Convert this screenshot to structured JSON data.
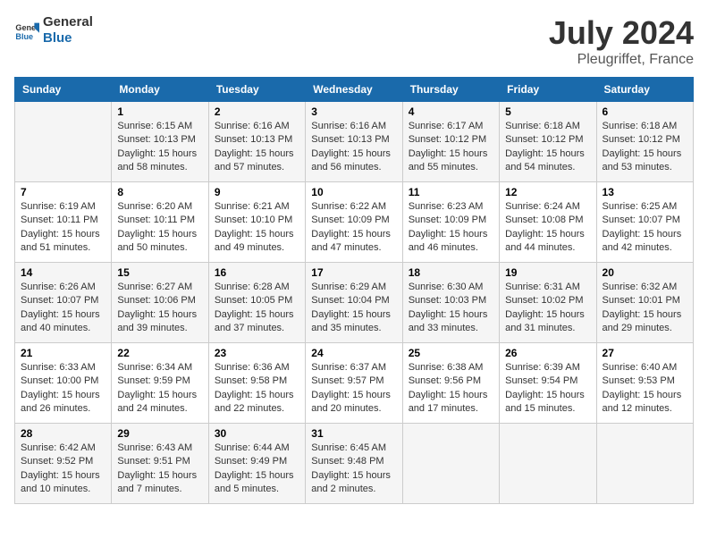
{
  "header": {
    "logo_line1": "General",
    "logo_line2": "Blue",
    "month": "July 2024",
    "location": "Pleugriffet, France"
  },
  "weekdays": [
    "Sunday",
    "Monday",
    "Tuesday",
    "Wednesday",
    "Thursday",
    "Friday",
    "Saturday"
  ],
  "weeks": [
    [
      {
        "day": "",
        "sunrise": "",
        "sunset": "",
        "daylight": ""
      },
      {
        "day": "1",
        "sunrise": "Sunrise: 6:15 AM",
        "sunset": "Sunset: 10:13 PM",
        "daylight": "Daylight: 15 hours and 58 minutes."
      },
      {
        "day": "2",
        "sunrise": "Sunrise: 6:16 AM",
        "sunset": "Sunset: 10:13 PM",
        "daylight": "Daylight: 15 hours and 57 minutes."
      },
      {
        "day": "3",
        "sunrise": "Sunrise: 6:16 AM",
        "sunset": "Sunset: 10:13 PM",
        "daylight": "Daylight: 15 hours and 56 minutes."
      },
      {
        "day": "4",
        "sunrise": "Sunrise: 6:17 AM",
        "sunset": "Sunset: 10:12 PM",
        "daylight": "Daylight: 15 hours and 55 minutes."
      },
      {
        "day": "5",
        "sunrise": "Sunrise: 6:18 AM",
        "sunset": "Sunset: 10:12 PM",
        "daylight": "Daylight: 15 hours and 54 minutes."
      },
      {
        "day": "6",
        "sunrise": "Sunrise: 6:18 AM",
        "sunset": "Sunset: 10:12 PM",
        "daylight": "Daylight: 15 hours and 53 minutes."
      }
    ],
    [
      {
        "day": "7",
        "sunrise": "Sunrise: 6:19 AM",
        "sunset": "Sunset: 10:11 PM",
        "daylight": "Daylight: 15 hours and 51 minutes."
      },
      {
        "day": "8",
        "sunrise": "Sunrise: 6:20 AM",
        "sunset": "Sunset: 10:11 PM",
        "daylight": "Daylight: 15 hours and 50 minutes."
      },
      {
        "day": "9",
        "sunrise": "Sunrise: 6:21 AM",
        "sunset": "Sunset: 10:10 PM",
        "daylight": "Daylight: 15 hours and 49 minutes."
      },
      {
        "day": "10",
        "sunrise": "Sunrise: 6:22 AM",
        "sunset": "Sunset: 10:09 PM",
        "daylight": "Daylight: 15 hours and 47 minutes."
      },
      {
        "day": "11",
        "sunrise": "Sunrise: 6:23 AM",
        "sunset": "Sunset: 10:09 PM",
        "daylight": "Daylight: 15 hours and 46 minutes."
      },
      {
        "day": "12",
        "sunrise": "Sunrise: 6:24 AM",
        "sunset": "Sunset: 10:08 PM",
        "daylight": "Daylight: 15 hours and 44 minutes."
      },
      {
        "day": "13",
        "sunrise": "Sunrise: 6:25 AM",
        "sunset": "Sunset: 10:07 PM",
        "daylight": "Daylight: 15 hours and 42 minutes."
      }
    ],
    [
      {
        "day": "14",
        "sunrise": "Sunrise: 6:26 AM",
        "sunset": "Sunset: 10:07 PM",
        "daylight": "Daylight: 15 hours and 40 minutes."
      },
      {
        "day": "15",
        "sunrise": "Sunrise: 6:27 AM",
        "sunset": "Sunset: 10:06 PM",
        "daylight": "Daylight: 15 hours and 39 minutes."
      },
      {
        "day": "16",
        "sunrise": "Sunrise: 6:28 AM",
        "sunset": "Sunset: 10:05 PM",
        "daylight": "Daylight: 15 hours and 37 minutes."
      },
      {
        "day": "17",
        "sunrise": "Sunrise: 6:29 AM",
        "sunset": "Sunset: 10:04 PM",
        "daylight": "Daylight: 15 hours and 35 minutes."
      },
      {
        "day": "18",
        "sunrise": "Sunrise: 6:30 AM",
        "sunset": "Sunset: 10:03 PM",
        "daylight": "Daylight: 15 hours and 33 minutes."
      },
      {
        "day": "19",
        "sunrise": "Sunrise: 6:31 AM",
        "sunset": "Sunset: 10:02 PM",
        "daylight": "Daylight: 15 hours and 31 minutes."
      },
      {
        "day": "20",
        "sunrise": "Sunrise: 6:32 AM",
        "sunset": "Sunset: 10:01 PM",
        "daylight": "Daylight: 15 hours and 29 minutes."
      }
    ],
    [
      {
        "day": "21",
        "sunrise": "Sunrise: 6:33 AM",
        "sunset": "Sunset: 10:00 PM",
        "daylight": "Daylight: 15 hours and 26 minutes."
      },
      {
        "day": "22",
        "sunrise": "Sunrise: 6:34 AM",
        "sunset": "Sunset: 9:59 PM",
        "daylight": "Daylight: 15 hours and 24 minutes."
      },
      {
        "day": "23",
        "sunrise": "Sunrise: 6:36 AM",
        "sunset": "Sunset: 9:58 PM",
        "daylight": "Daylight: 15 hours and 22 minutes."
      },
      {
        "day": "24",
        "sunrise": "Sunrise: 6:37 AM",
        "sunset": "Sunset: 9:57 PM",
        "daylight": "Daylight: 15 hours and 20 minutes."
      },
      {
        "day": "25",
        "sunrise": "Sunrise: 6:38 AM",
        "sunset": "Sunset: 9:56 PM",
        "daylight": "Daylight: 15 hours and 17 minutes."
      },
      {
        "day": "26",
        "sunrise": "Sunrise: 6:39 AM",
        "sunset": "Sunset: 9:54 PM",
        "daylight": "Daylight: 15 hours and 15 minutes."
      },
      {
        "day": "27",
        "sunrise": "Sunrise: 6:40 AM",
        "sunset": "Sunset: 9:53 PM",
        "daylight": "Daylight: 15 hours and 12 minutes."
      }
    ],
    [
      {
        "day": "28",
        "sunrise": "Sunrise: 6:42 AM",
        "sunset": "Sunset: 9:52 PM",
        "daylight": "Daylight: 15 hours and 10 minutes."
      },
      {
        "day": "29",
        "sunrise": "Sunrise: 6:43 AM",
        "sunset": "Sunset: 9:51 PM",
        "daylight": "Daylight: 15 hours and 7 minutes."
      },
      {
        "day": "30",
        "sunrise": "Sunrise: 6:44 AM",
        "sunset": "Sunset: 9:49 PM",
        "daylight": "Daylight: 15 hours and 5 minutes."
      },
      {
        "day": "31",
        "sunrise": "Sunrise: 6:45 AM",
        "sunset": "Sunset: 9:48 PM",
        "daylight": "Daylight: 15 hours and 2 minutes."
      },
      {
        "day": "",
        "sunrise": "",
        "sunset": "",
        "daylight": ""
      },
      {
        "day": "",
        "sunrise": "",
        "sunset": "",
        "daylight": ""
      },
      {
        "day": "",
        "sunrise": "",
        "sunset": "",
        "daylight": ""
      }
    ]
  ]
}
